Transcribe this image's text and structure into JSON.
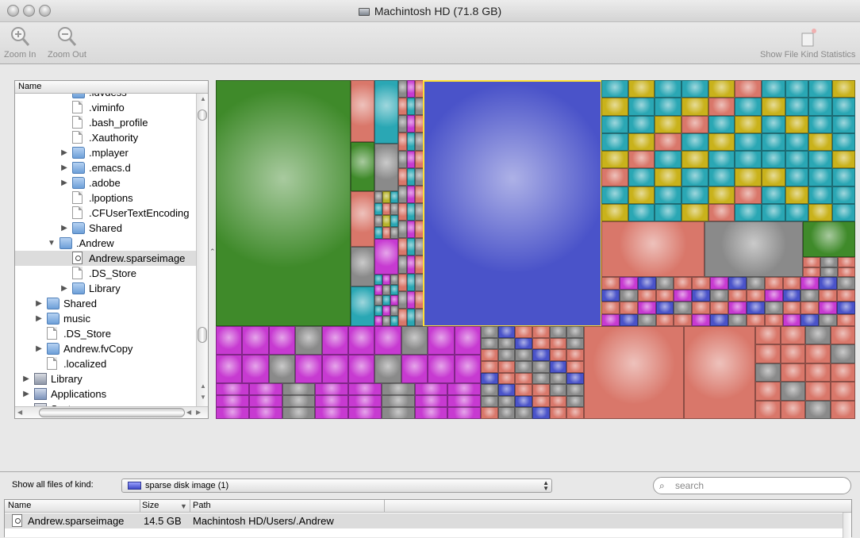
{
  "window": {
    "title": "Machintosh HD (71.8 GB)"
  },
  "toolbar": {
    "zoom_in_label": "Zoom In",
    "zoom_out_label": "Zoom Out",
    "stats_label": "Show File Kind Statistics"
  },
  "outline": {
    "column_header": "Name",
    "rows": [
      {
        "label": ".idvdess",
        "icon": "folder-icon",
        "disclosure": ""
      },
      {
        "label": ".viminfo",
        "icon": "document-icon",
        "disclosure": ""
      },
      {
        "label": ".bash_profile",
        "icon": "document-icon",
        "disclosure": ""
      },
      {
        "label": ".Xauthority",
        "icon": "document-icon",
        "disclosure": ""
      },
      {
        "label": ".mplayer",
        "icon": "folder-icon",
        "disclosure": "▶"
      },
      {
        "label": ".emacs.d",
        "icon": "folder-icon",
        "disclosure": "▶"
      },
      {
        "label": ".adobe",
        "icon": "folder-icon",
        "disclosure": "▶"
      },
      {
        "label": ".lpoptions",
        "icon": "document-icon",
        "disclosure": ""
      },
      {
        "label": ".CFUserTextEncoding",
        "icon": "document-icon",
        "disclosure": ""
      },
      {
        "label": "Shared",
        "icon": "folder-icon",
        "disclosure": "▶"
      },
      {
        "label": ".Andrew",
        "icon": "folder-icon",
        "disclosure": "▼"
      },
      {
        "label": "Andrew.sparseimage",
        "icon": "disk-image-icon",
        "disclosure": ""
      },
      {
        "label": ".DS_Store",
        "icon": "document-icon",
        "disclosure": ""
      },
      {
        "label": "Library",
        "icon": "folder-icon",
        "disclosure": "▶"
      },
      {
        "label": "Shared",
        "icon": "folder-icon",
        "disclosure": "▶"
      },
      {
        "label": "music",
        "icon": "folder-icon",
        "disclosure": "▶"
      },
      {
        "label": ".DS_Store",
        "icon": "document-icon",
        "disclosure": ""
      },
      {
        "label": "Andrew.fvCopy",
        "icon": "folder-icon",
        "disclosure": "▶"
      },
      {
        "label": ".localized",
        "icon": "document-icon",
        "disclosure": ""
      },
      {
        "label": "Library",
        "icon": "library-icon",
        "disclosure": "▶"
      },
      {
        "label": "Applications",
        "icon": "applications-icon",
        "disclosure": "▶"
      },
      {
        "label": "System",
        "icon": "library-icon",
        "disclosure": "▼"
      }
    ]
  },
  "filter": {
    "label": "Show all files of kind:",
    "selected_kind": "sparse disk image  (1)",
    "search_placeholder": "search"
  },
  "results": {
    "columns": [
      "Name",
      "Size",
      "Path"
    ],
    "rows": [
      {
        "name": "Andrew.sparseimage",
        "size": "14.5 GB",
        "path": "Machintosh HD/Users/.Andrew"
      }
    ]
  },
  "colors": {
    "selection_border": "#ffe033",
    "green": "#3f8a2a",
    "blue": "#4a53c9",
    "cyan": "#2aa7b4",
    "yellow": "#c9b21b",
    "salmon": "#d9776a",
    "magenta": "#c73ad1",
    "gray": "#8a8a8a"
  }
}
